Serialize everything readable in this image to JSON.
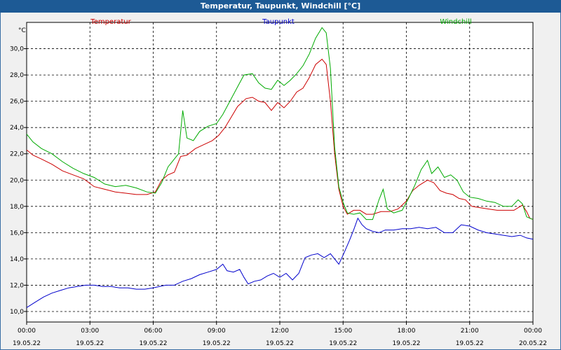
{
  "window": {
    "title": "Temperatur, Taupunkt, Windchill [°C]"
  },
  "chart_data": {
    "type": "line",
    "title": "Temperatur, Taupunkt, Windchill [°C]",
    "ylabel": "°C",
    "xlabel": "",
    "x_range_hours": [
      0,
      24
    ],
    "ylim": [
      9.2,
      32.0
    ],
    "y_ticks": [
      "10,0",
      "12,0",
      "14,0",
      "16,0",
      "18,0",
      "20,0",
      "22,0",
      "24,0",
      "26,0",
      "28,0",
      "30,0"
    ],
    "y_tick_values": [
      10,
      12,
      14,
      16,
      18,
      20,
      22,
      24,
      26,
      28,
      30
    ],
    "x_ticks": [
      {
        "h": 0,
        "time": "00:00",
        "date": "19.05.22"
      },
      {
        "h": 3,
        "time": "03:00",
        "date": "19.05.22"
      },
      {
        "h": 6,
        "time": "06:00",
        "date": "19.05.22"
      },
      {
        "h": 9,
        "time": "09:00",
        "date": "19.05.22"
      },
      {
        "h": 12,
        "time": "12:00",
        "date": "19.05.22"
      },
      {
        "h": 15,
        "time": "15:00",
        "date": "19.05.22"
      },
      {
        "h": 18,
        "time": "18:00",
        "date": "19.05.22"
      },
      {
        "h": 21,
        "time": "21:00",
        "date": "19.05.22"
      },
      {
        "h": 24,
        "time": "00:00",
        "date": "20.05.22"
      }
    ],
    "grid": true,
    "series": [
      {
        "name": "Temperatur",
        "color": "#cc0000",
        "points": [
          [
            0,
            22.3
          ],
          [
            0.3,
            21.9
          ],
          [
            0.7,
            21.6
          ],
          [
            1.2,
            21.2
          ],
          [
            1.7,
            20.7
          ],
          [
            2.2,
            20.4
          ],
          [
            2.7,
            20.1
          ],
          [
            3.2,
            19.5
          ],
          [
            3.7,
            19.3
          ],
          [
            4.2,
            19.1
          ],
          [
            4.7,
            19.0
          ],
          [
            5.2,
            18.9
          ],
          [
            5.7,
            18.9
          ],
          [
            6.1,
            19.1
          ],
          [
            6.4,
            20.0
          ],
          [
            6.7,
            20.4
          ],
          [
            7.0,
            20.6
          ],
          [
            7.3,
            21.8
          ],
          [
            7.6,
            21.9
          ],
          [
            8.0,
            22.4
          ],
          [
            8.4,
            22.7
          ],
          [
            8.8,
            23.0
          ],
          [
            9.1,
            23.4
          ],
          [
            9.4,
            24.0
          ],
          [
            9.7,
            24.8
          ],
          [
            10.0,
            25.6
          ],
          [
            10.4,
            26.2
          ],
          [
            10.7,
            26.3
          ],
          [
            11.0,
            26.0
          ],
          [
            11.3,
            25.9
          ],
          [
            11.6,
            25.3
          ],
          [
            11.9,
            25.9
          ],
          [
            12.2,
            25.5
          ],
          [
            12.5,
            26.0
          ],
          [
            12.8,
            26.7
          ],
          [
            13.1,
            27.0
          ],
          [
            13.4,
            27.8
          ],
          [
            13.7,
            28.8
          ],
          [
            14.0,
            29.2
          ],
          [
            14.2,
            28.8
          ],
          [
            14.4,
            26.0
          ],
          [
            14.6,
            22.0
          ],
          [
            14.8,
            19.3
          ],
          [
            15.0,
            18.0
          ],
          [
            15.2,
            17.4
          ],
          [
            15.5,
            17.7
          ],
          [
            15.8,
            17.7
          ],
          [
            16.1,
            17.4
          ],
          [
            16.4,
            17.4
          ],
          [
            16.8,
            17.6
          ],
          [
            17.2,
            17.6
          ],
          [
            17.6,
            17.8
          ],
          [
            18.0,
            18.4
          ],
          [
            18.3,
            19.2
          ],
          [
            18.6,
            19.6
          ],
          [
            19.0,
            20.0
          ],
          [
            19.3,
            19.8
          ],
          [
            19.6,
            19.2
          ],
          [
            19.9,
            19.0
          ],
          [
            20.2,
            18.9
          ],
          [
            20.5,
            18.6
          ],
          [
            20.8,
            18.5
          ],
          [
            21.1,
            18.0
          ],
          [
            21.5,
            17.9
          ],
          [
            21.9,
            17.8
          ],
          [
            22.3,
            17.7
          ],
          [
            22.7,
            17.7
          ],
          [
            23.1,
            17.7
          ],
          [
            23.5,
            18.1
          ],
          [
            23.7,
            17.6
          ],
          [
            23.85,
            17.1
          ],
          [
            24.0,
            17.0
          ]
        ]
      },
      {
        "name": "Taupunkt",
        "color": "#0000cc",
        "points": [
          [
            0,
            10.3
          ],
          [
            0.4,
            10.7
          ],
          [
            0.8,
            11.1
          ],
          [
            1.2,
            11.4
          ],
          [
            1.6,
            11.6
          ],
          [
            2.0,
            11.8
          ],
          [
            2.4,
            11.9
          ],
          [
            2.8,
            12.0
          ],
          [
            3.2,
            12.0
          ],
          [
            3.6,
            11.9
          ],
          [
            4.0,
            11.9
          ],
          [
            4.4,
            11.8
          ],
          [
            4.8,
            11.8
          ],
          [
            5.2,
            11.7
          ],
          [
            5.6,
            11.7
          ],
          [
            6.0,
            11.8
          ],
          [
            6.3,
            11.9
          ],
          [
            6.6,
            12.0
          ],
          [
            7.0,
            12.0
          ],
          [
            7.4,
            12.3
          ],
          [
            7.8,
            12.5
          ],
          [
            8.2,
            12.8
          ],
          [
            8.6,
            13.0
          ],
          [
            9.0,
            13.2
          ],
          [
            9.3,
            13.6
          ],
          [
            9.5,
            13.1
          ],
          [
            9.8,
            13.0
          ],
          [
            10.1,
            13.2
          ],
          [
            10.3,
            12.6
          ],
          [
            10.5,
            12.1
          ],
          [
            10.8,
            12.3
          ],
          [
            11.1,
            12.4
          ],
          [
            11.4,
            12.7
          ],
          [
            11.7,
            12.9
          ],
          [
            12.0,
            12.6
          ],
          [
            12.3,
            12.9
          ],
          [
            12.6,
            12.4
          ],
          [
            12.9,
            12.9
          ],
          [
            13.2,
            14.1
          ],
          [
            13.5,
            14.3
          ],
          [
            13.8,
            14.4
          ],
          [
            14.1,
            14.1
          ],
          [
            14.4,
            14.4
          ],
          [
            14.6,
            14.0
          ],
          [
            14.8,
            13.6
          ],
          [
            15.0,
            14.3
          ],
          [
            15.3,
            15.4
          ],
          [
            15.5,
            16.2
          ],
          [
            15.7,
            17.1
          ],
          [
            15.9,
            16.6
          ],
          [
            16.1,
            16.3
          ],
          [
            16.4,
            16.1
          ],
          [
            16.7,
            16.0
          ],
          [
            17.0,
            16.2
          ],
          [
            17.4,
            16.2
          ],
          [
            17.8,
            16.3
          ],
          [
            18.2,
            16.3
          ],
          [
            18.6,
            16.4
          ],
          [
            19.0,
            16.3
          ],
          [
            19.4,
            16.4
          ],
          [
            19.8,
            16.0
          ],
          [
            20.2,
            16.0
          ],
          [
            20.6,
            16.6
          ],
          [
            21.0,
            16.5
          ],
          [
            21.4,
            16.2
          ],
          [
            21.8,
            16.0
          ],
          [
            22.2,
            15.9
          ],
          [
            22.6,
            15.8
          ],
          [
            23.0,
            15.7
          ],
          [
            23.4,
            15.8
          ],
          [
            23.7,
            15.6
          ],
          [
            24.0,
            15.5
          ]
        ]
      },
      {
        "name": "Windchill",
        "color": "#00aa00",
        "points": [
          [
            0,
            23.5
          ],
          [
            0.3,
            22.9
          ],
          [
            0.7,
            22.4
          ],
          [
            1.2,
            22.0
          ],
          [
            1.7,
            21.4
          ],
          [
            2.2,
            20.9
          ],
          [
            2.7,
            20.5
          ],
          [
            3.2,
            20.2
          ],
          [
            3.7,
            19.7
          ],
          [
            4.2,
            19.5
          ],
          [
            4.7,
            19.6
          ],
          [
            5.2,
            19.4
          ],
          [
            5.7,
            19.1
          ],
          [
            6.1,
            19.0
          ],
          [
            6.4,
            19.8
          ],
          [
            6.7,
            21.0
          ],
          [
            7.0,
            21.6
          ],
          [
            7.2,
            22.0
          ],
          [
            7.4,
            25.3
          ],
          [
            7.6,
            23.2
          ],
          [
            7.9,
            23.0
          ],
          [
            8.2,
            23.7
          ],
          [
            8.6,
            24.1
          ],
          [
            9.0,
            24.3
          ],
          [
            9.3,
            25.0
          ],
          [
            9.6,
            25.9
          ],
          [
            10.0,
            27.1
          ],
          [
            10.3,
            28.0
          ],
          [
            10.7,
            28.1
          ],
          [
            11.0,
            27.4
          ],
          [
            11.3,
            27.0
          ],
          [
            11.6,
            26.9
          ],
          [
            11.9,
            27.6
          ],
          [
            12.2,
            27.2
          ],
          [
            12.5,
            27.6
          ],
          [
            12.8,
            28.1
          ],
          [
            13.1,
            28.7
          ],
          [
            13.4,
            29.6
          ],
          [
            13.7,
            30.8
          ],
          [
            14.0,
            31.6
          ],
          [
            14.2,
            31.2
          ],
          [
            14.4,
            28.5
          ],
          [
            14.6,
            22.5
          ],
          [
            14.8,
            19.5
          ],
          [
            15.0,
            18.3
          ],
          [
            15.2,
            17.5
          ],
          [
            15.5,
            17.4
          ],
          [
            15.8,
            17.5
          ],
          [
            16.1,
            17.0
          ],
          [
            16.4,
            17.0
          ],
          [
            16.7,
            18.5
          ],
          [
            16.9,
            19.3
          ],
          [
            17.1,
            17.8
          ],
          [
            17.4,
            17.5
          ],
          [
            17.8,
            17.7
          ],
          [
            18.1,
            18.6
          ],
          [
            18.4,
            19.6
          ],
          [
            18.7,
            20.8
          ],
          [
            19.0,
            21.5
          ],
          [
            19.2,
            20.5
          ],
          [
            19.5,
            21.0
          ],
          [
            19.8,
            20.2
          ],
          [
            20.1,
            20.4
          ],
          [
            20.4,
            20.0
          ],
          [
            20.7,
            19.1
          ],
          [
            21.0,
            18.7
          ],
          [
            21.4,
            18.6
          ],
          [
            21.8,
            18.4
          ],
          [
            22.2,
            18.3
          ],
          [
            22.6,
            18.0
          ],
          [
            23.0,
            18.0
          ],
          [
            23.3,
            18.5
          ],
          [
            23.5,
            18.2
          ],
          [
            23.7,
            17.2
          ],
          [
            24.0,
            17.0
          ]
        ]
      }
    ]
  }
}
